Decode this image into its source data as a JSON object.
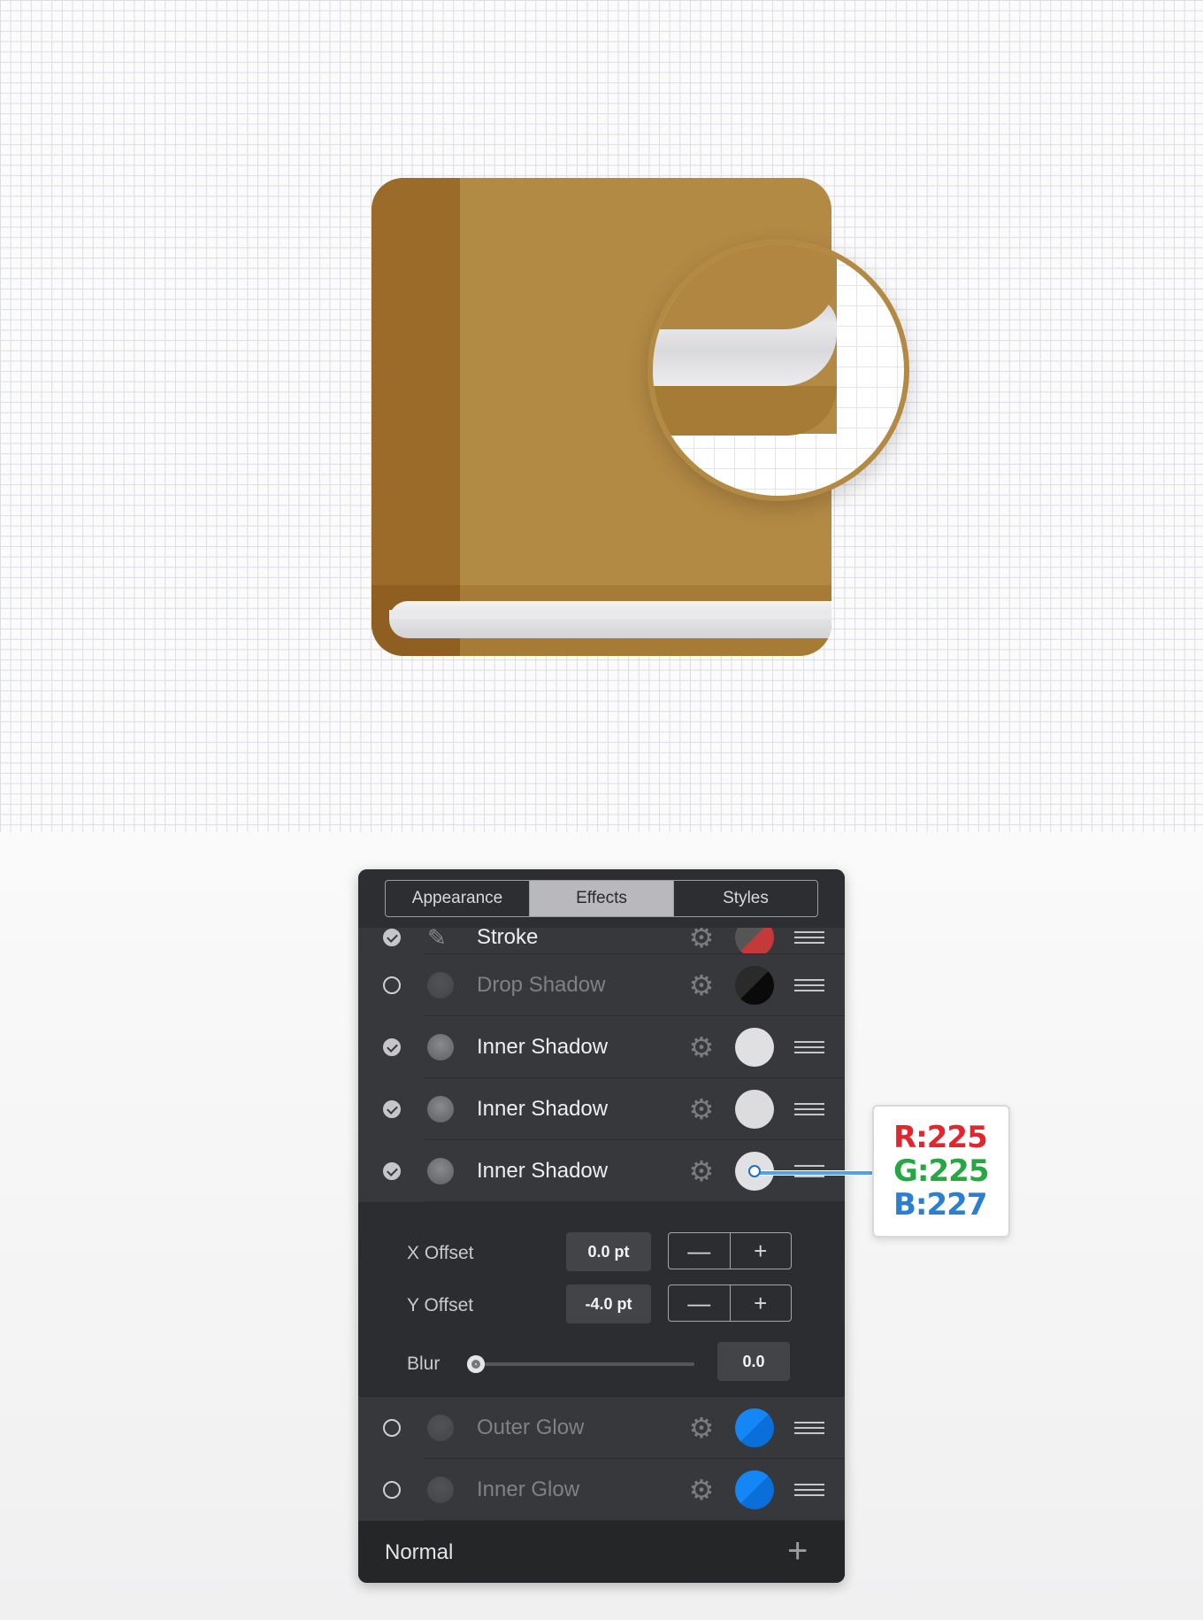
{
  "panel": {
    "tabs": [
      {
        "label": "Appearance",
        "active": false
      },
      {
        "label": "Effects",
        "active": true
      },
      {
        "label": "Styles",
        "active": false
      }
    ],
    "effects": [
      {
        "label": "Stroke",
        "enabled": true,
        "color": "#c43a3a",
        "dim": false
      },
      {
        "label": "Drop Shadow",
        "enabled": false,
        "color": "#0a0a0a",
        "dim": true
      },
      {
        "label": "Inner Shadow",
        "enabled": true,
        "color": "#e0e0e2",
        "dim": false
      },
      {
        "label": "Inner Shadow",
        "enabled": true,
        "color": "#dcdcde",
        "dim": false
      },
      {
        "label": "Inner Shadow",
        "enabled": true,
        "color": "#e1e1e3",
        "dim": false
      }
    ],
    "detail": {
      "x_offset_label": "X Offset",
      "x_offset_value": "0.0 pt",
      "y_offset_label": "Y Offset",
      "y_offset_value": "-4.0 pt",
      "blur_label": "Blur",
      "blur_value": "0.0",
      "minus": "—",
      "plus": "+"
    },
    "effects_after": [
      {
        "label": "Outer Glow",
        "enabled": false,
        "color": "#0a7cf0",
        "dim": true
      },
      {
        "label": "Inner Glow",
        "enabled": false,
        "color": "#0a7cf0",
        "dim": true
      }
    ],
    "footer": {
      "blend_mode": "Normal",
      "add_icon": "+"
    }
  },
  "callout": {
    "r": "R:225",
    "g": "G:225",
    "b": "B:227",
    "r_color": "#e0262e",
    "g_color": "#27a744",
    "b_color": "#2a7fd0"
  },
  "icons": {
    "gear": "⚙"
  }
}
